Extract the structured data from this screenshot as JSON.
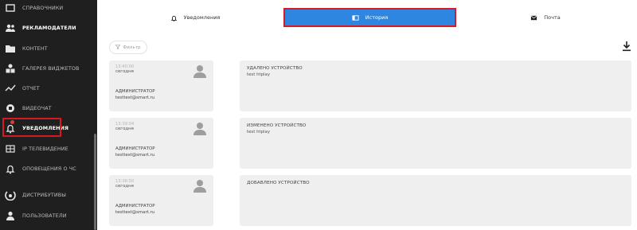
{
  "sidebar": {
    "items": [
      {
        "label": "СПРАВОЧНИКИ",
        "icon": "folder-icon"
      },
      {
        "label": "РЕКЛАМОДАТЕЛИ",
        "icon": "users-icon"
      },
      {
        "label": "КОНТЕНТ",
        "icon": "folder-icon"
      },
      {
        "label": "ГАЛЕРЕЯ ВИДЖЕТОВ",
        "icon": "widgets-icon"
      },
      {
        "label": "ОТЧЕТ",
        "icon": "chart-line-icon"
      },
      {
        "label": "ВИДЕОЧАТ",
        "icon": "videochat-icon"
      },
      {
        "label": "УВЕДОМЛЕНИЯ",
        "icon": "bell-icon"
      },
      {
        "label": "IP ТЕЛЕВИДЕНИЕ",
        "icon": "tv-icon"
      },
      {
        "label": "ОПОВЕЩЕНИЯ О ЧС",
        "icon": "bell-alert-icon"
      },
      {
        "label": "ДИСТРИБУТИВЫ",
        "icon": "distribution-icon"
      },
      {
        "label": "ПОЛЬЗОВАТЕЛИ",
        "icon": "user-icon"
      }
    ],
    "active": "УВЕДОМЛЕНИЯ"
  },
  "tabs": {
    "notifications": "Уведомления",
    "history": "История",
    "mail": "Почта"
  },
  "toolbar": {
    "filter_label": "Фильтр"
  },
  "history": [
    {
      "time": "13:40:00",
      "day": "сегодня",
      "role": "АДМИНИСТРАТОР",
      "email": "testtest@smart.ru",
      "action": "УДАЛЕНО УСТРОЙСТВО",
      "device": "test htplay"
    },
    {
      "time": "13:39:04",
      "day": "сегодня",
      "role": "АДМИНИСТРАТОР",
      "email": "testtest@smart.ru",
      "action": "ИЗМЕНЕНО УСТРОЙСТВО",
      "device": "test htplay"
    },
    {
      "time": "13:38:50",
      "day": "сегодня",
      "role": "АДМИНИСТРАТОР",
      "email": "testtest@smart.ru",
      "action": "ДОБАВЛЕНО УСТРОЙСТВО",
      "device": ""
    }
  ],
  "colors": {
    "sidebar_bg": "#1f1f1f",
    "active_tab": "#2f86e0",
    "highlight": "#d71921",
    "card_bg": "#efefef",
    "badge": "#e53935"
  }
}
